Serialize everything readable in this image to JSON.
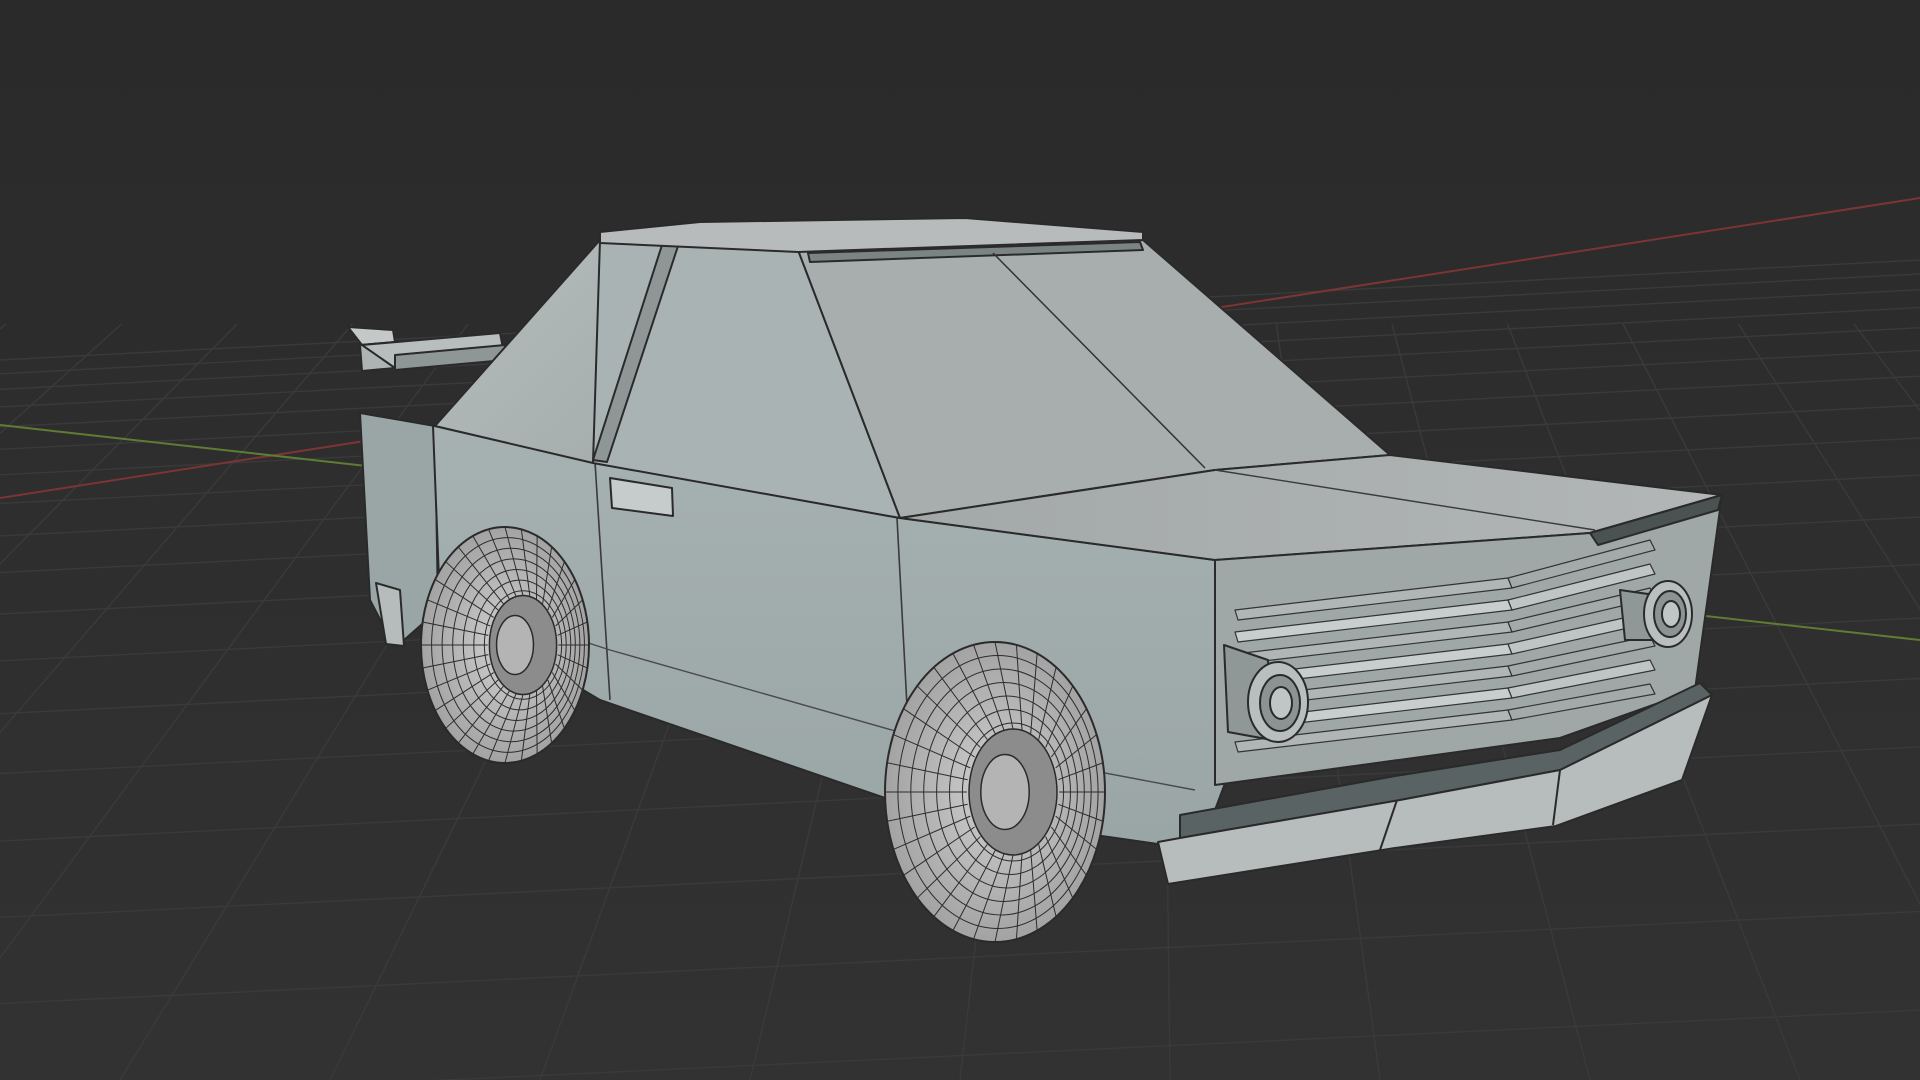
{
  "viewport": {
    "background_color": "#2c2c2c",
    "grid_line_color": "#3a3a3a",
    "x_axis_color": "#8a3a3a",
    "y_axis_color": "#6a8a3a"
  },
  "scene": {
    "object": "low-poly-car",
    "mode": "wireframe-overlay",
    "body_color": "#a9b0b0",
    "wheel_color": "#bdbdbd",
    "edge_color": "#222222"
  }
}
